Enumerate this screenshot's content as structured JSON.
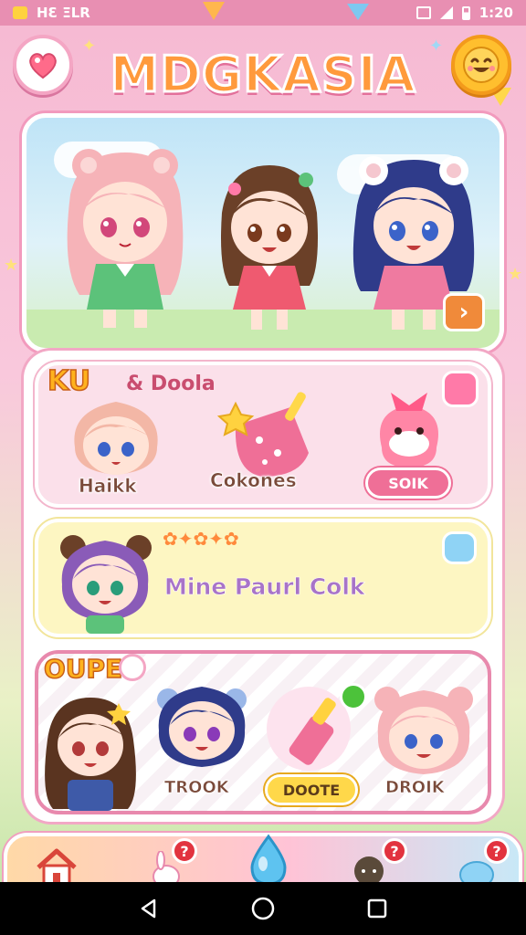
{
  "status_bar": {
    "left_text": "ΗƐ ΞLR",
    "right_text": "1:20"
  },
  "header": {
    "title": "MDGKASIA"
  },
  "hero": {
    "arrow_label": "›"
  },
  "section_pink": {
    "title": "KU",
    "subtitle": "& Doola",
    "items": [
      {
        "label": "Haikk"
      },
      {
        "label": "Cokones"
      },
      {
        "label": "SOIK"
      }
    ]
  },
  "section_yellow": {
    "title": "Mine Paurl Colk"
  },
  "section_white": {
    "title": "OUPE",
    "items": [
      {
        "label": "TROOK"
      },
      {
        "label": "DOOTE"
      },
      {
        "label": "DROIK"
      }
    ]
  },
  "bottom_nav": {
    "badge": "?"
  },
  "colors": {
    "accent": "#ef6f97",
    "title_orange": "#ff9a3c",
    "badge_red": "#e2333f",
    "brand_yellow": "#ffd84a"
  },
  "icons": [
    "heart-icon",
    "smile-face-icon",
    "chevron-right-icon",
    "home-icon",
    "water-drop-icon",
    "back-icon",
    "home-circle-icon",
    "recents-icon"
  ]
}
